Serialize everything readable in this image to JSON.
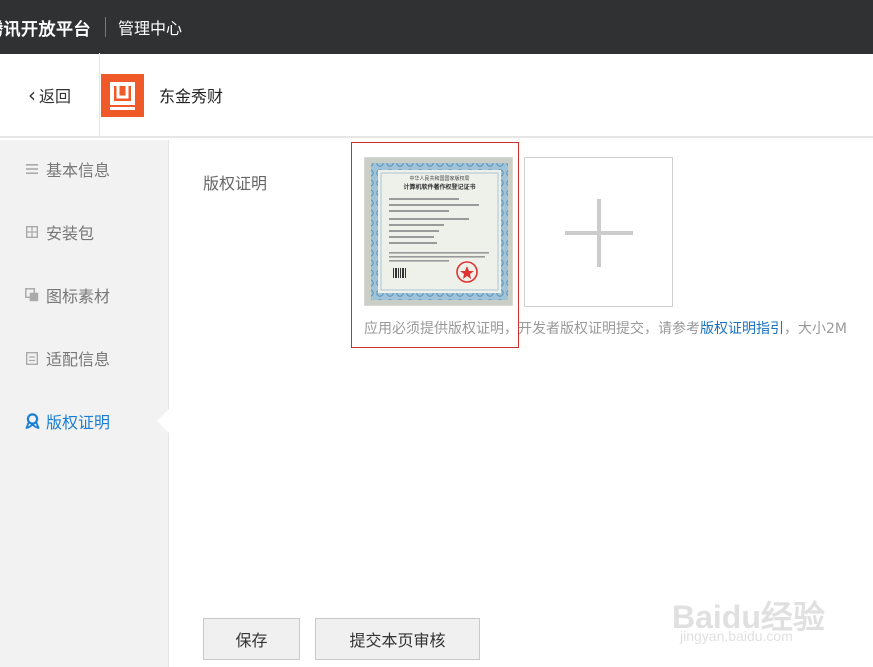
{
  "topbar": {
    "brand": "腾讯开放平台",
    "center": "管理中心"
  },
  "apphead": {
    "back_label": "返回",
    "app_name": "东金秀财"
  },
  "sidebar": {
    "items": [
      {
        "label": "基本信息",
        "icon": "list-icon",
        "active": false
      },
      {
        "label": "安装包",
        "icon": "grid-icon",
        "active": false
      },
      {
        "label": "图标素材",
        "icon": "layers-icon",
        "active": false
      },
      {
        "label": "适配信息",
        "icon": "document-icon",
        "active": false
      },
      {
        "label": "版权证明",
        "icon": "award-icon",
        "active": true
      }
    ]
  },
  "main": {
    "field_label": "版权证明",
    "hint_prefix": "应用必须提供版权证明，开发者版权证明提交，请参考",
    "hint_link": "版权证明指引",
    "hint_suffix": "，大小2M"
  },
  "certificate": {
    "title_line1": "中华人民共和国国家版权局",
    "title_line2": "计算机软件著作权登记证书"
  },
  "actions": {
    "save_label": "保存",
    "submit_label": "提交本页审核"
  },
  "watermark": {
    "line1": "Baidu经验",
    "line2": "jingyan.baidu.com"
  },
  "colors": {
    "topbar_bg": "#2f3133",
    "accent": "#1a7ed4",
    "logo": "#f05a28",
    "highlight_border": "#d42d2d"
  }
}
